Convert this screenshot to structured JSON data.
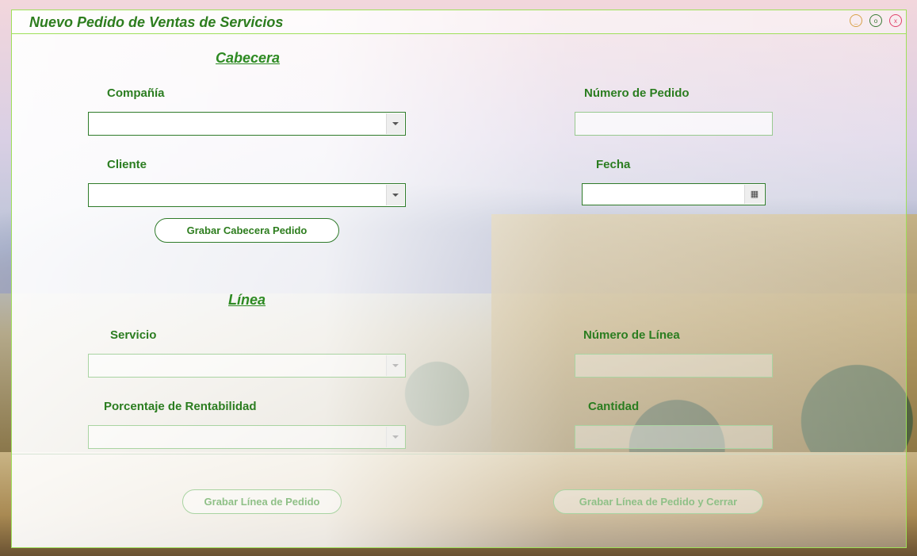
{
  "window": {
    "title": "Nuevo Pedido de Ventas de  Servicios",
    "minimize_glyph": "_",
    "maximize_glyph": "o",
    "close_glyph": "x"
  },
  "header": {
    "section_title": "Cabecera",
    "company_label": "Compañía",
    "company_value": "",
    "order_number_label": "Número de Pedido",
    "order_number_value": "",
    "client_label": "Cliente",
    "client_value": "",
    "date_label": "Fecha",
    "date_value": "",
    "save_header_button": "Grabar Cabecera Pedido"
  },
  "line": {
    "section_title": "Línea",
    "service_label": "Servicio",
    "service_value": "",
    "line_number_label": "Número de Línea",
    "line_number_value": "",
    "profit_label": "Porcentaje de Rentabilidad",
    "profit_value": "",
    "quantity_label": "Cantidad",
    "quantity_value": ""
  },
  "footer": {
    "save_line_button": "Grabar Línea de Pedido",
    "save_line_close_button": "Grabar Línea de Pedido y Cerrar"
  },
  "icons": {
    "calendar": "calendar-icon",
    "dropdown": "chevron-down-icon"
  },
  "colors": {
    "accent": "#2d7d1e",
    "window_border": "#9fe05a",
    "close": "#e0436a",
    "minimize": "#d8a14a"
  }
}
